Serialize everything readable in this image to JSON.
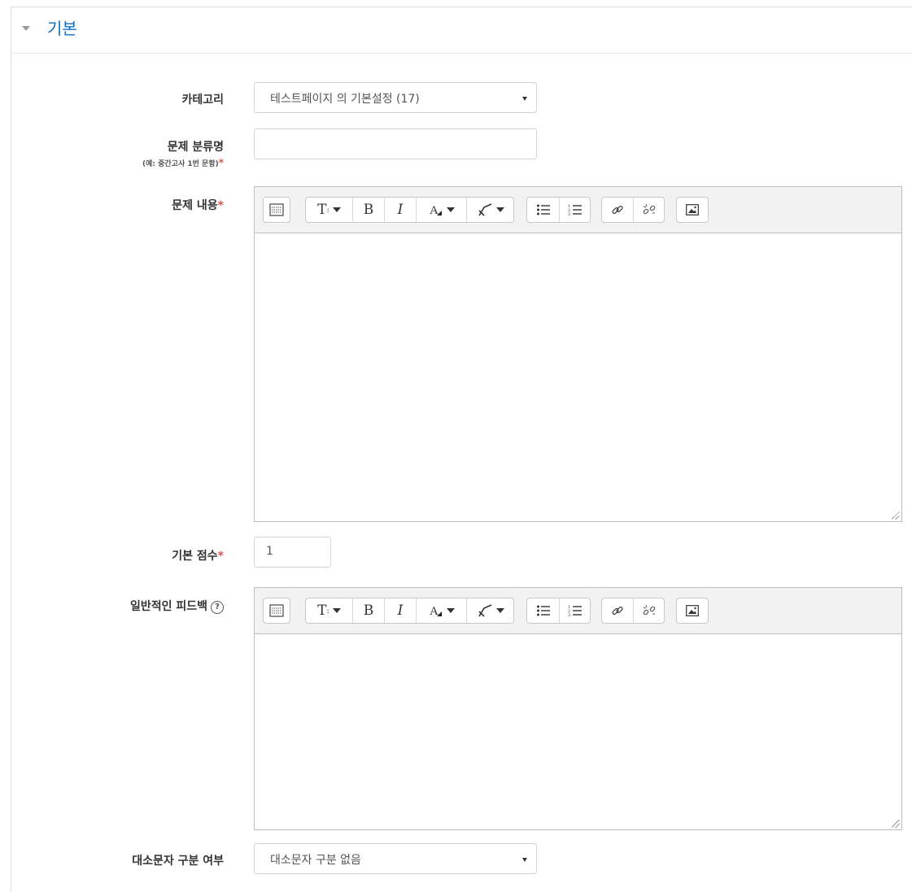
{
  "section": {
    "title": "기본"
  },
  "fields": {
    "category": {
      "label": "카테고리",
      "value": "테스트페이지 의 기본설정 (17)"
    },
    "question_name": {
      "label": "문제 분류명",
      "hint": "(예: 중간고사 1번 문항)",
      "value": ""
    },
    "question_text": {
      "label": "문제 내용"
    },
    "default_mark": {
      "label": "기본 점수",
      "value": "1"
    },
    "general_feedback": {
      "label": "일반적인 피드백",
      "help_icon": "?"
    },
    "case_sensitivity": {
      "label": "대소문자 구분 여부",
      "value": "대소문자 구분 없음"
    }
  },
  "required_marker": "*",
  "toolbar": {
    "buttons": [
      "show-more-icon",
      "paragraph-style-icon",
      "bold-icon",
      "italic-icon",
      "font-color-icon",
      "background-color-icon",
      "unordered-list-icon",
      "ordered-list-icon",
      "link-icon",
      "unlink-icon",
      "image-icon"
    ],
    "bold_glyph": "B",
    "italic_glyph": "I",
    "style_glyph": "T"
  },
  "colors": {
    "accent": "#0f6fc5",
    "required": "#d9534f"
  }
}
